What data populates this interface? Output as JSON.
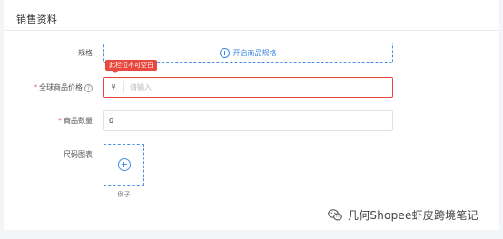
{
  "section": {
    "title": "销售资料"
  },
  "spec": {
    "label": "规格",
    "button_label": "开启商品规格"
  },
  "price": {
    "label": "全球商品价格",
    "required_mark": "*",
    "error_message": "此栏位不可空白",
    "currency_symbol": "¥",
    "placeholder": "请输入",
    "value": ""
  },
  "quantity": {
    "label": "商品数量",
    "required_mark": "*",
    "value": "0"
  },
  "size_chart": {
    "label": "尺码图表",
    "example_link": "例子"
  },
  "watermark": {
    "text": "几何Shopee虾皮跨境笔记"
  },
  "colors": {
    "accent": "#3b86e0",
    "error": "#e9483e",
    "background": "#f4f5f7"
  }
}
